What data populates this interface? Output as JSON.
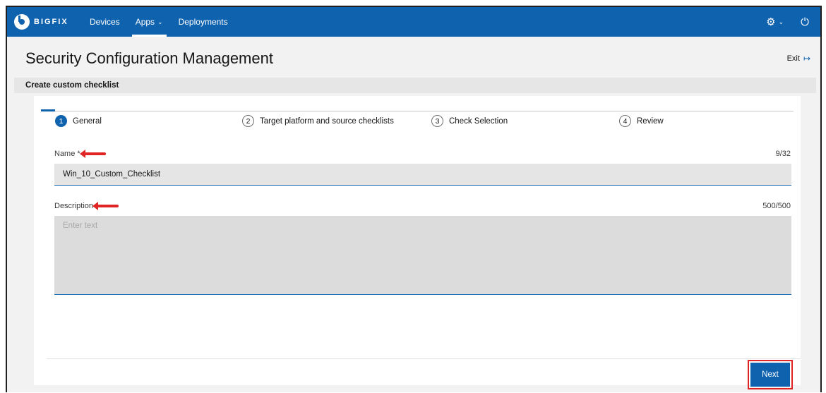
{
  "nav": {
    "brand": "BIGFIX",
    "items": [
      {
        "label": "Devices"
      },
      {
        "label": "Apps"
      },
      {
        "label": "Deployments"
      }
    ],
    "apps_caret": "⌄",
    "gear_caret": "⌄"
  },
  "header": {
    "title": "Security Configuration Management",
    "exit_label": "Exit"
  },
  "subheader": {
    "title": "Create custom checklist"
  },
  "stepper": {
    "steps": [
      {
        "num": "1",
        "label": "General"
      },
      {
        "num": "2",
        "label": "Target platform and source checklists"
      },
      {
        "num": "3",
        "label": "Check Selection"
      },
      {
        "num": "4",
        "label": "Review"
      }
    ]
  },
  "form": {
    "name_label": "Name *",
    "name_value": "Win_10_Custom_Checklist",
    "name_counter": "9/32",
    "description_label": "Description",
    "description_placeholder": "Enter text",
    "description_counter": "500/500"
  },
  "footer": {
    "next_label": "Next"
  },
  "colors": {
    "brand_blue": "#0f62ae",
    "highlight_red": "#e02424"
  }
}
